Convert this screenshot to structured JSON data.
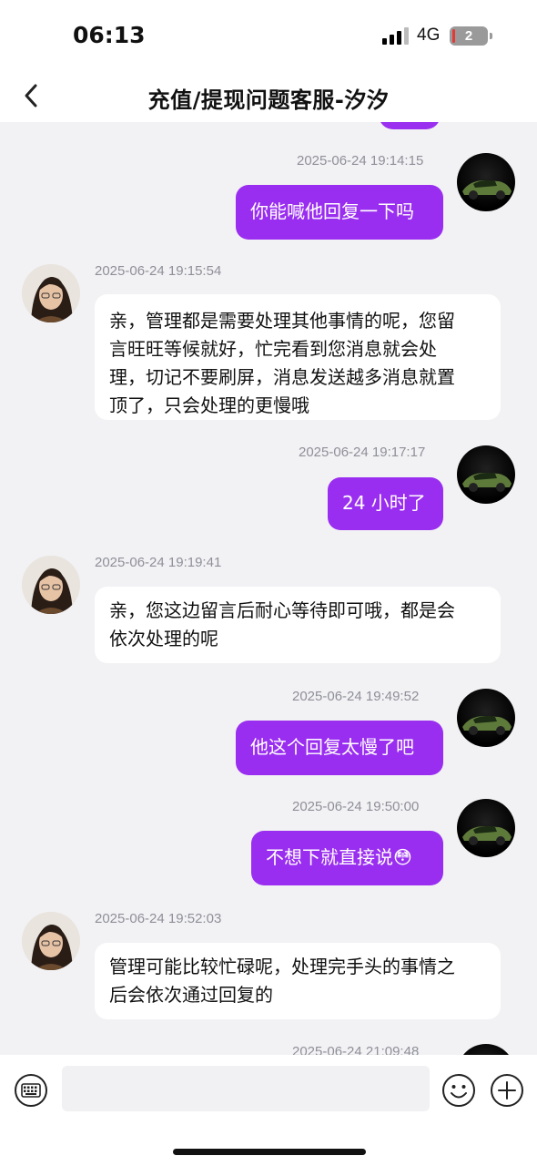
{
  "status_bar": {
    "time": "06:13",
    "network": "4G",
    "battery": "2"
  },
  "header": {
    "title": "充值/提现问题客服-汐汐"
  },
  "messages": [
    {
      "side": "out",
      "timestamp": "2025-06-24 19:14:15",
      "text": "你能喊他回复一下吗"
    },
    {
      "side": "in",
      "timestamp": "2025-06-24 19:15:54",
      "lines": [
        "亲，管理都是需要处理其他事情的呢，您留",
        "言旺旺等候就好，忙完看到您消息就会处",
        "理，切记不要刷屏，消息发送越多消息就置",
        "顶了，只会处理的更慢哦"
      ]
    },
    {
      "side": "out",
      "timestamp": "2025-06-24 19:17:17",
      "text": "24 小时了"
    },
    {
      "side": "in",
      "timestamp": "2025-06-24 19:19:41",
      "lines": [
        "亲，您这边留言后耐心等待即可哦，都是会",
        "依次处理的呢"
      ]
    },
    {
      "side": "out",
      "timestamp": "2025-06-24 19:49:52",
      "text": "他这个回复太慢了吧"
    },
    {
      "side": "out",
      "timestamp": "2025-06-24 19:50:00",
      "text": "不想下就直接说",
      "emoji": "😳"
    },
    {
      "side": "in",
      "timestamp": "2025-06-24 19:52:03",
      "lines": [
        "管理可能比较忙碌呢，处理完手头的事情之",
        "后会依次通过回复的"
      ]
    },
    {
      "side": "out",
      "timestamp": "2025-06-24 21:09:48"
    }
  ],
  "icons": {
    "back": "chevron-left-icon",
    "keyboard": "keyboard-icon",
    "emoji": "smiley-icon",
    "plus": "plus-circle-icon"
  },
  "colors": {
    "outgoing_bubble": "#9a2ef0",
    "incoming_bubble": "#ffffff",
    "background": "#f2f2f4"
  }
}
